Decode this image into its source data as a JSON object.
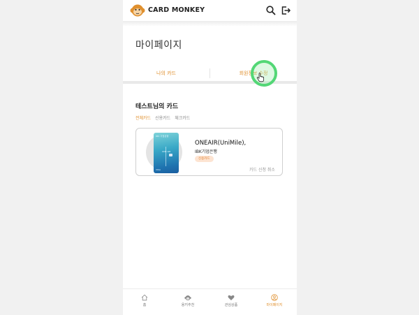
{
  "header": {
    "brand": "CARD MONKEY",
    "logo_icon": "monkey-logo-icon",
    "actions": [
      "search-icon",
      "logout-icon"
    ]
  },
  "page": {
    "title": "마이페이지"
  },
  "tabs": [
    {
      "label": "나의 카드"
    },
    {
      "label": "회원정보 수정"
    }
  ],
  "section": {
    "title": "테스트님의 카드",
    "filters": [
      {
        "label": "전체카드",
        "active": true
      },
      {
        "label": "신용카드",
        "active": false
      },
      {
        "label": "체크카드",
        "active": false
      }
    ]
  },
  "card": {
    "name": "ONEAIR(UniMile),",
    "bank": "IBK기업은행",
    "badge": "신용카드",
    "cancel_label": "카드 신청 취소",
    "image_brand": "IBK 기업은행",
    "image_title": "ONE AIR",
    "image_bottom": "VISA"
  },
  "bottom_nav": [
    {
      "label": "홈",
      "icon": "home-icon",
      "active": false
    },
    {
      "label": "용키추천",
      "icon": "monkey-recommend-icon",
      "active": false
    },
    {
      "label": "관심상품",
      "icon": "heart-icon",
      "active": false
    },
    {
      "label": "마이페이지",
      "icon": "user-icon",
      "active": true
    }
  ],
  "colors": {
    "accent": "#e0902f",
    "cursor_ring": "#53d776"
  }
}
